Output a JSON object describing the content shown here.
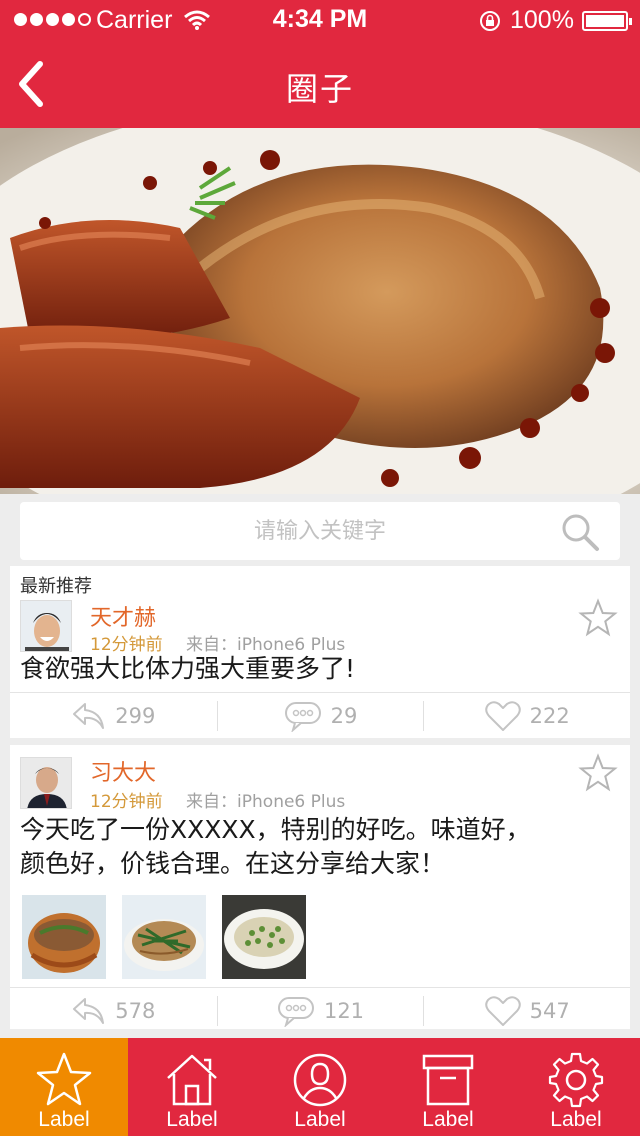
{
  "status_bar": {
    "carrier": "Carrier",
    "time": "4:34 PM",
    "battery": "100%",
    "signal_icon": "signal-dots-icon",
    "wifi_icon": "wifi-icon",
    "lock_icon": "rotation-lock-icon",
    "battery_icon": "battery-icon"
  },
  "nav": {
    "title": "圈子",
    "back_icon": "chevron-left-icon"
  },
  "search": {
    "placeholder": "请输入关键字",
    "icon": "search-icon"
  },
  "feed": {
    "section_title": "最新推荐",
    "posts": [
      {
        "username": "天才赫",
        "time_ago": "12分钟前",
        "source": "来自：iPhone6 Plus",
        "text": "食欲强大比体力强大重要多了!",
        "shares": "299",
        "comments": "29",
        "likes": "222"
      },
      {
        "username": "习大大",
        "time_ago": "12分钟前",
        "source": "来自：iPhone6 Plus",
        "text_line1": "今天吃了一份XXXXX，特别的好吃。味道好，",
        "text_line2": "颜色好，价钱合理。在这分享给大家！",
        "shares": "578",
        "comments": "121",
        "likes": "547"
      }
    ]
  },
  "tab_bar": {
    "tabs": [
      {
        "label": "Label",
        "icon": "star-icon"
      },
      {
        "label": "Label",
        "icon": "home-icon"
      },
      {
        "label": "Label",
        "icon": "user-icon"
      },
      {
        "label": "Label",
        "icon": "archive-box-icon"
      },
      {
        "label": "Label",
        "icon": "gear-icon"
      }
    ],
    "active_index": 0
  },
  "colors": {
    "brand_red": "#e1283f",
    "active_tab_orange": "#f08a00",
    "username_orange": "#e2672a"
  }
}
